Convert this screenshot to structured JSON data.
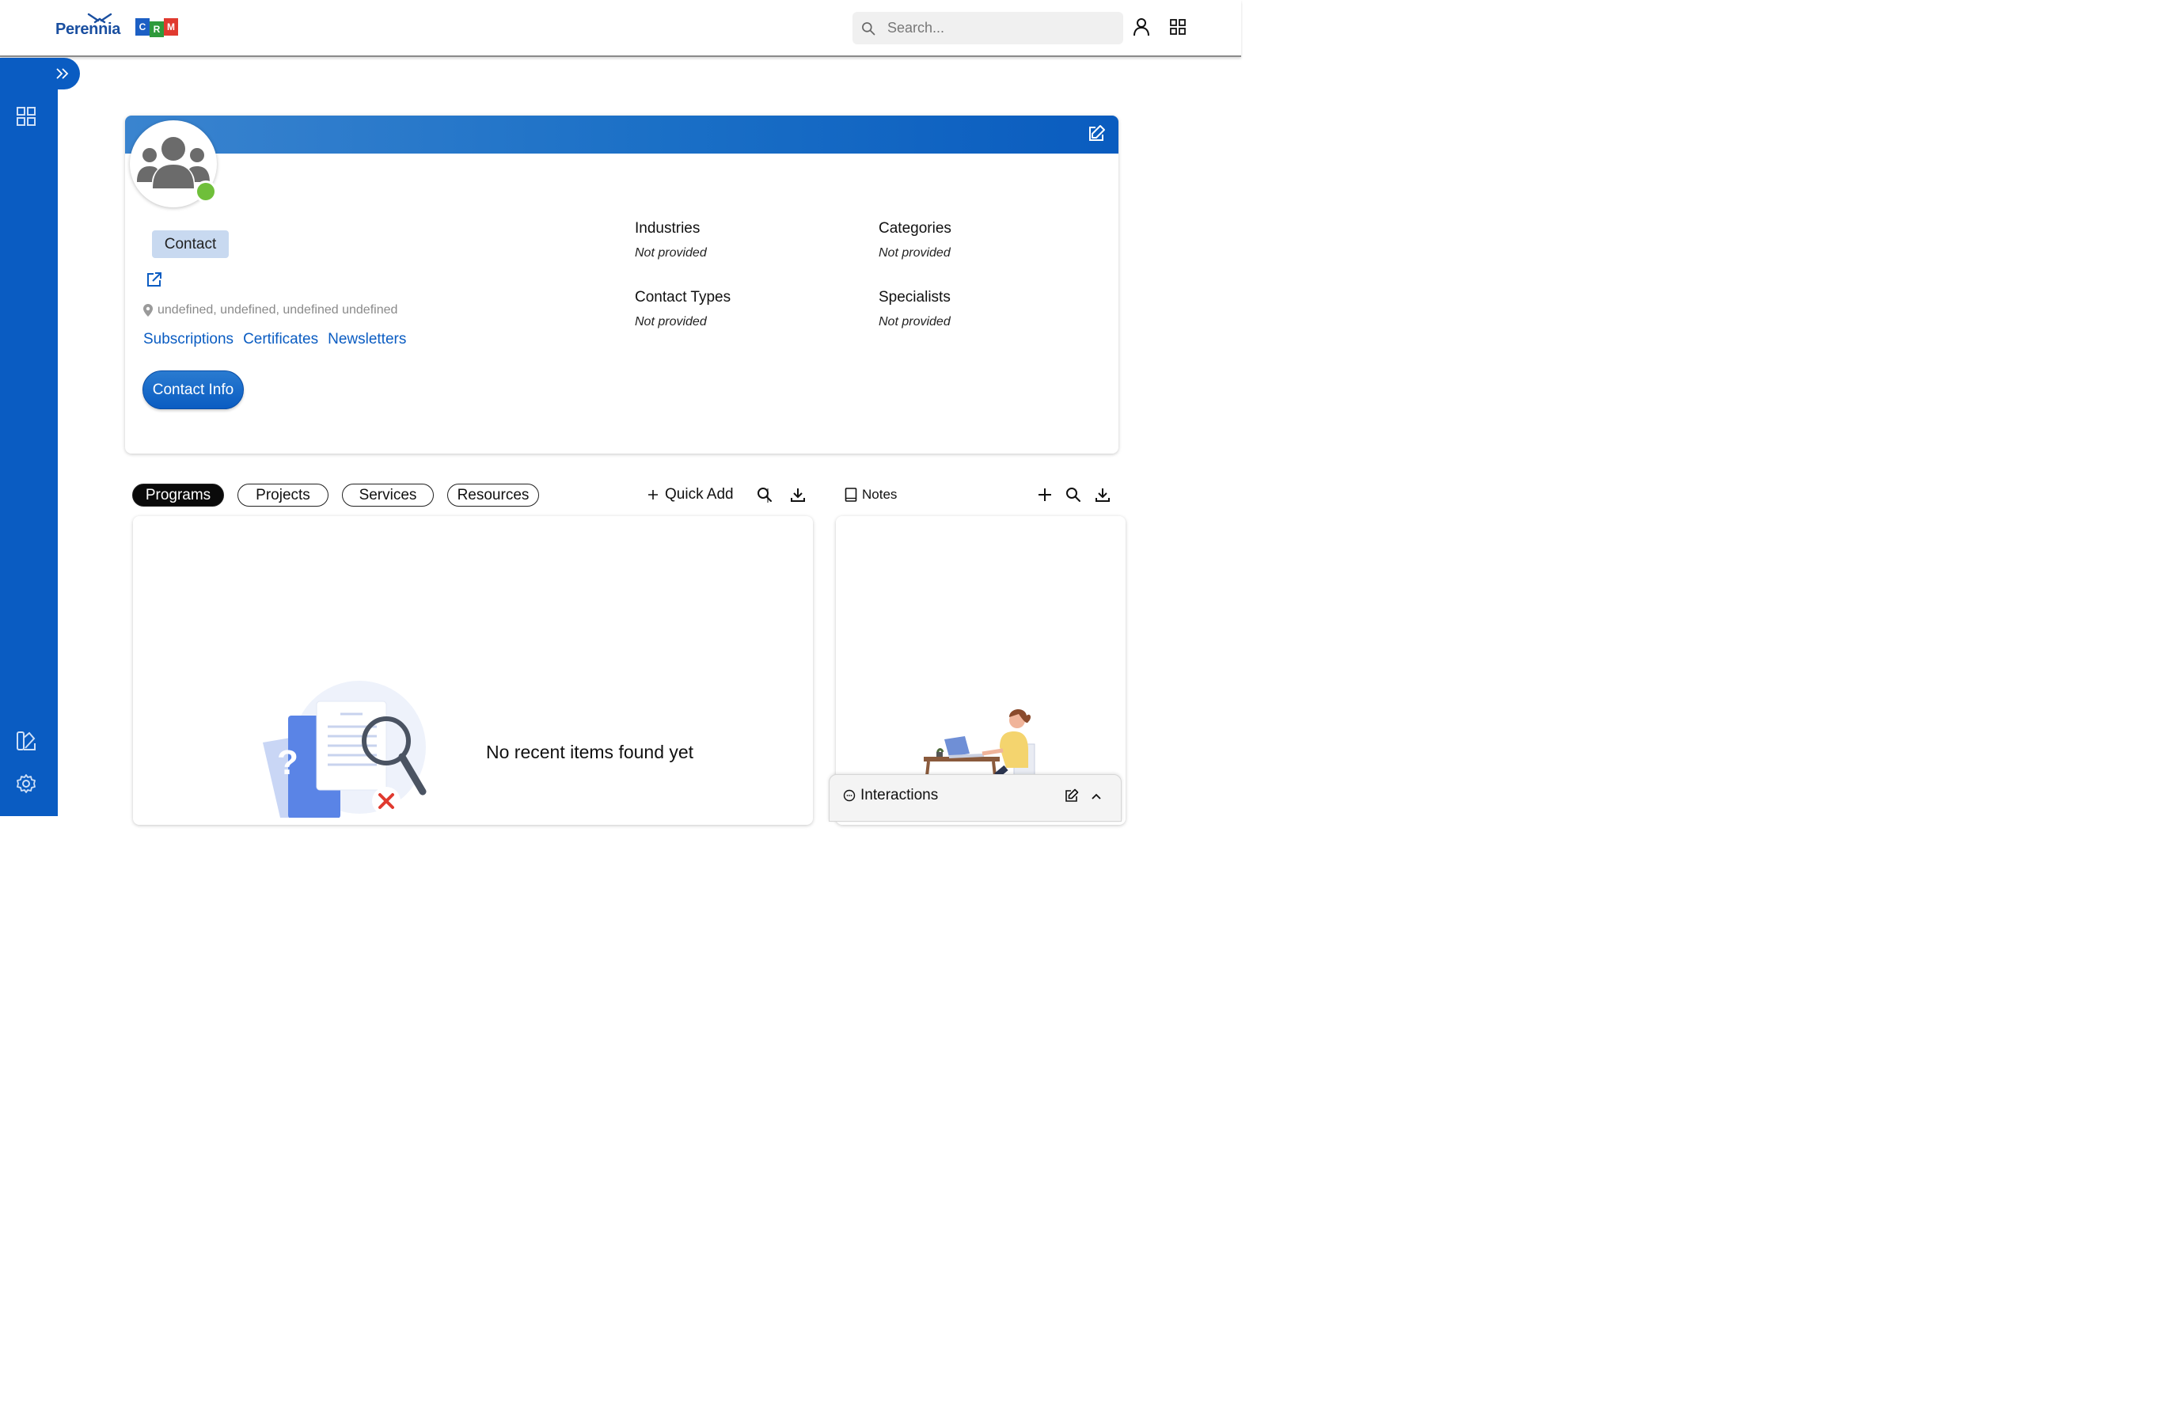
{
  "app": {
    "logo_text": "Perennia",
    "crm_letters": [
      "C",
      "R",
      "M"
    ]
  },
  "header": {
    "search_placeholder": "Search..."
  },
  "profile": {
    "type_chip": "Contact",
    "address": "undefined, undefined, undefined undefined",
    "links": [
      "Subscriptions",
      "Certificates",
      "Newsletters"
    ],
    "contact_info_button": "Contact Info",
    "fields": [
      {
        "label": "Industries",
        "value": "Not provided"
      },
      {
        "label": "Categories",
        "value": "Not provided"
      },
      {
        "label": "Contact Types",
        "value": "Not provided"
      },
      {
        "label": "Specialists",
        "value": "Not provided"
      }
    ]
  },
  "tabs": [
    "Programs",
    "Projects",
    "Services",
    "Resources"
  ],
  "active_tab": "Programs",
  "toolbar": {
    "quick_add": "Quick Add"
  },
  "programs_panel": {
    "empty_message": "No recent items found yet"
  },
  "notes": {
    "title": "Notes"
  },
  "interactions": {
    "title": "Interactions"
  },
  "colors": {
    "brand_blue": "#0a5cc2",
    "status_online": "#6fbf3a",
    "chip_bg": "#c8d9f0"
  }
}
